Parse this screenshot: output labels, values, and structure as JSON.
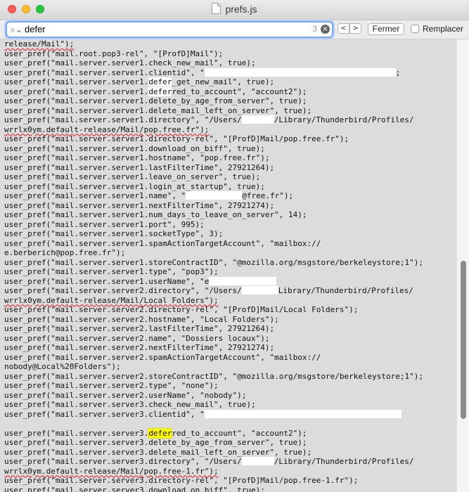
{
  "window": {
    "title": "prefs.js"
  },
  "findbar": {
    "search_value": "defer",
    "match_count": "3",
    "prev_label": "<",
    "next_label": ">",
    "close_label": "Fermer",
    "replace_label": "Remplacer"
  },
  "colors": {
    "editor_bg": "#dcdcdc",
    "current_match": "#ffff00",
    "other_match": "#ffffff",
    "focus_ring": "#7aa7f0"
  },
  "code_lines": [
    "release/Mail\");",
    "user_pref(\"mail.root.pop3-rel\", \"[ProfD]Mail\");",
    "user_pref(\"mail.server.server1.check_new_mail\", true);",
    "user_pref(\"mail.server.server1.clientid\", \"",
    "user_pref(\"mail.server.server1.",
    "user_pref(\"mail.server.server1.",
    "user_pref(\"mail.server.server1.delete_by_age_from_server\", true);",
    "user_pref(\"mail.server.server1.delete_mail_left_on_server\", true);",
    "user_pref(\"mail.server.server1.directory\", \"/Users/",
    "wrrlx0ym.default-release/Mail/pop.free.fr\");",
    "user_pref(\"mail.server.server1.directory-rel\", \"[ProfD]Mail/pop.free.fr\");",
    "user_pref(\"mail.server.server1.download_on_biff\", true);",
    "user_pref(\"mail.server.server1.hostname\", \"pop.free.fr\");",
    "user_pref(\"mail.server.server1.lastFilterTime\", 27921264);",
    "user_pref(\"mail.server.server1.leave_on_server\", true);",
    "user_pref(\"mail.server.server1.login_at_startup\", true);",
    "user_pref(\"mail.server.server1.name\", \"",
    "user_pref(\"mail.server.server1.nextFilterTime\", 27921274);",
    "user_pref(\"mail.server.server1.num_days_to_leave_on_server\", 14);",
    "user_pref(\"mail.server.server1.port\", 995);",
    "user_pref(\"mail.server.server1.socketType\", 3);",
    "user_pref(\"mail.server.server1.spamActionTargetAccount\", \"mailbox://",
    "e.berberich@pop.free.fr\");",
    "user_pref(\"mail.server.server1.storeContractID\", \"@mozilla.org/msgstore/berkeleystore;1\");",
    "user_pref(\"mail.server.server1.type\", \"pop3\");",
    "user_pref(\"mail.server.server1.userName\", \"e",
    "user_pref(\"mail.server.server2.directory\", \"/Users/",
    "wrrlx0ym.default-release/Mail/Local Folders\");",
    "user_pref(\"mail.server.server2.directory-rel\", \"[ProfD]Mail/Local Folders\");",
    "user_pref(\"mail.server.server2.hostname\", \"Local Folders\");",
    "user_pref(\"mail.server.server2.lastFilterTime\", 27921264);",
    "user_pref(\"mail.server.server2.name\", \"Dossiers locaux\");",
    "user_pref(\"mail.server.server2.nextFilterTime\", 27921274);",
    "user_pref(\"mail.server.server2.spamActionTargetAccount\", \"mailbox://",
    "nobody@Local%20Folders\");",
    "user_pref(\"mail.server.server2.storeContractID\", \"@mozilla.org/msgstore/berkeleystore;1\");",
    "user_pref(\"mail.server.server2.type\", \"none\");",
    "user_pref(\"mail.server.server2.userName\", \"nobody\");",
    "user_pref(\"mail.server.server3.check_new_mail\", true);",
    "user_pref(\"mail.server.server3.clientid\", \"",
    "",
    "user_pref(\"mail.server.server3.",
    "user_pref(\"mail.server.server3.delete_by_age_from_server\", true);",
    "user_pref(\"mail.server.server3.delete_mail_left_on_server\", true);",
    "user_pref(\"mail.server.server3.directory\", \"/Users/",
    "wrrlx0ym.default-release/Mail/pop.free-1.fr\");",
    "user_pref(\"mail.server.server3.directory-rel\", \"[ProfD]Mail/pop.free-1.fr\");",
    "user_pref(\"mail.server.server3.download_on_biff\", true);"
  ],
  "fragments": {
    "l4_end": ";",
    "l5_match": "defer",
    "l5_rest": "_get_new_mail\", true);",
    "l6_match": "defer",
    "l6_rest": "red_to_account\", \"account2\");",
    "l9_rest": "/Library/Thunderbird/Profiles/",
    "l17_rest": "@free.fr\");",
    "l27_rest": "Library/Thunderbird/Profiles/",
    "l42_match": "defer",
    "l42_rest": "red_to_account\", \"account2\");",
    "l45_rest": "/Library/Thunderbird/Profiles/"
  }
}
